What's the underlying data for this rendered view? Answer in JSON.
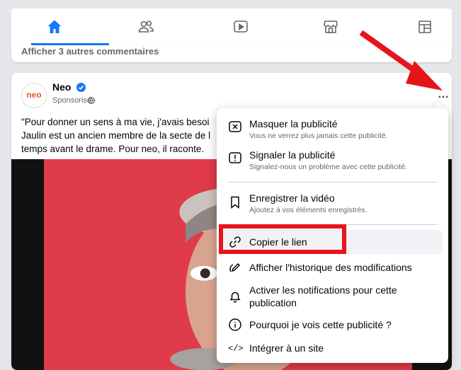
{
  "nav": {
    "icons": [
      "home-icon",
      "friends-icon",
      "watch-icon",
      "marketplace-icon",
      "groups-icon"
    ]
  },
  "comments": {
    "more_label": "Afficher 3 autres commentaires"
  },
  "post": {
    "avatar_text": "neo",
    "author": "Neo",
    "sponsored": "Sponsorisé ·",
    "text": "\"Pour donner un sens à ma vie, j'avais besoi\nJaulin est un ancien membre de la secte de l\ntemps avant le drame. Pour neo, il raconte.",
    "more_icon": "…"
  },
  "menu": {
    "hide": {
      "title": "Masquer la publicité",
      "sub": "Vous ne verrez plus jamais cette publicité."
    },
    "report": {
      "title": "Signaler la publicité",
      "sub": "Signalez-nous un problème avec cette publicité."
    },
    "save": {
      "title": "Enregistrer la vidéo",
      "sub": "Ajoutez à vos éléments enregistrés."
    },
    "copy": {
      "title": "Copier le lien"
    },
    "history": {
      "title": "Afficher l'historique des modifications"
    },
    "notify": {
      "title": "Activer les notifications pour cette\npublication"
    },
    "why": {
      "title": "Pourquoi je vois cette publicité ?"
    },
    "embed": {
      "title": "Intégrer à un site",
      "icon": "</>"
    }
  },
  "colors": {
    "accent": "#1877f2",
    "annotation": "#e8141b"
  }
}
